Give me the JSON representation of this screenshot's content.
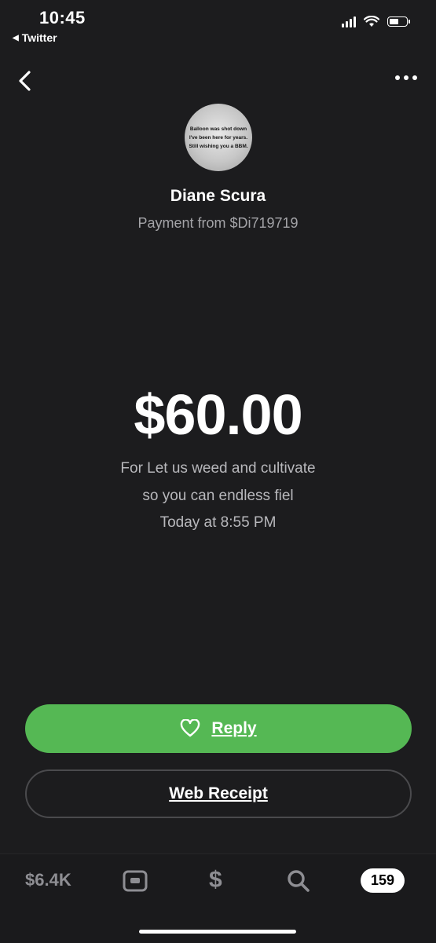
{
  "status_bar": {
    "time": "10:45",
    "back_app": "Twitter"
  },
  "header": {
    "back_icon": "chevron-left-icon",
    "more_icon": "ellipsis-icon"
  },
  "profile": {
    "avatar_text": [
      "Balloon was shot down",
      "I've been here for years.",
      "Still wishing you a BBM."
    ],
    "name": "Diane Scura",
    "subtitle": "Payment from $Di719719"
  },
  "payment": {
    "amount": "$60.00",
    "note_line1": "For Let us weed and cultivate",
    "note_line2": "so you can  endless fiel",
    "timestamp": "Today at 8:55 PM"
  },
  "actions": {
    "reply_label": "Reply",
    "reply_icon": "heart-icon",
    "web_receipt_label": "Web Receipt"
  },
  "tab_bar": {
    "balance": "$6.4K",
    "card_icon": "card-icon",
    "dollar_label": "$",
    "search_icon": "search-icon",
    "activity_count": "159"
  },
  "colors": {
    "background": "#1c1c1e",
    "accent_green": "#55b854",
    "muted_text": "#a4a4a8"
  }
}
